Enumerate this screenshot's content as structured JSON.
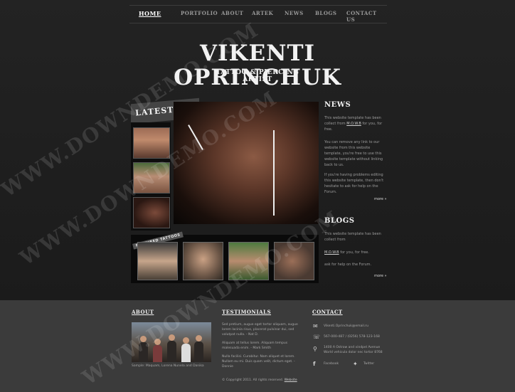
{
  "nav": {
    "items": [
      {
        "label": "HOME",
        "active": true
      },
      {
        "label": "PORTFOLIO",
        "active": false
      },
      {
        "label": "ABOUT",
        "active": false
      },
      {
        "label": "ARTEK",
        "active": false
      },
      {
        "label": "NEWS",
        "active": false
      },
      {
        "label": "BLOGS",
        "active": false
      },
      {
        "label": "CONTACT US",
        "active": false
      }
    ]
  },
  "header": {
    "title": "VIKENTI OPRINCHUK",
    "tagline": "TATTOO & PIERCING ARTIST"
  },
  "gallery": {
    "latest_title": "LATEST WORK",
    "featured_label": "FEATURED TATTOOS"
  },
  "news": {
    "heading": "NEWS",
    "p1": "This website template has been collect from",
    "p1_link": "M.O.W.B",
    "p1_tail": "for you, for free.",
    "p2": "You can remove any link to our website from this website template, you're free to use this website template without linking back to us.",
    "p3": "If you're having problems editing this website template, then don't hesitate to ask for help on the Forum.",
    "more": "more »"
  },
  "blogs": {
    "heading": "BLOGS",
    "p1": "This website template has been collect from",
    "p2_link": "M.O.W.B",
    "p2_tail": "for you, for free.",
    "p3": "ask for help on the Forum.",
    "more": "more »"
  },
  "footer": {
    "about_heading": "ABOUT",
    "about_caption": "Sample: Maquam, Lorena Nunela and Danika",
    "testimonials_heading": "TESTIMONIALS",
    "testimonials_p1": "Sed pretium, augue eget tortor aliquam, augue lorem lacinia risus, placerat pulvinar dui, sed volutpat nulla. - Nat D.",
    "testimonials_p2": "Aliquam at tellus lorem. Aliquam tempus malesuada enim. - Mark Smith",
    "testimonials_p3": "Nulla facilisi. Curabitur. Nam aliquet et lorem. Nullam eu mi. Duis quam velit, dictum eget. - Donnie",
    "copyright": "© Copyright 2011. All rights reserved.",
    "copyright_link": "Website",
    "contact_heading": "CONTACT",
    "email": "Vikenti.Oprinchuk@email.ru",
    "phone": "567-000-487 / (0256) 578-123-168",
    "address": "1400 A Ostrow and vindpel Avenue World vehicula dolor nec tortor 8768",
    "facebook": "Facebook",
    "twitter": "Twitter"
  },
  "watermark": "WWW.DOWNDEMO.COM",
  "colors": {
    "background": "#1d1d1d",
    "footer": "#3b3b3b",
    "heading": "#f2f2f2",
    "body_text": "#9b9b9b"
  }
}
